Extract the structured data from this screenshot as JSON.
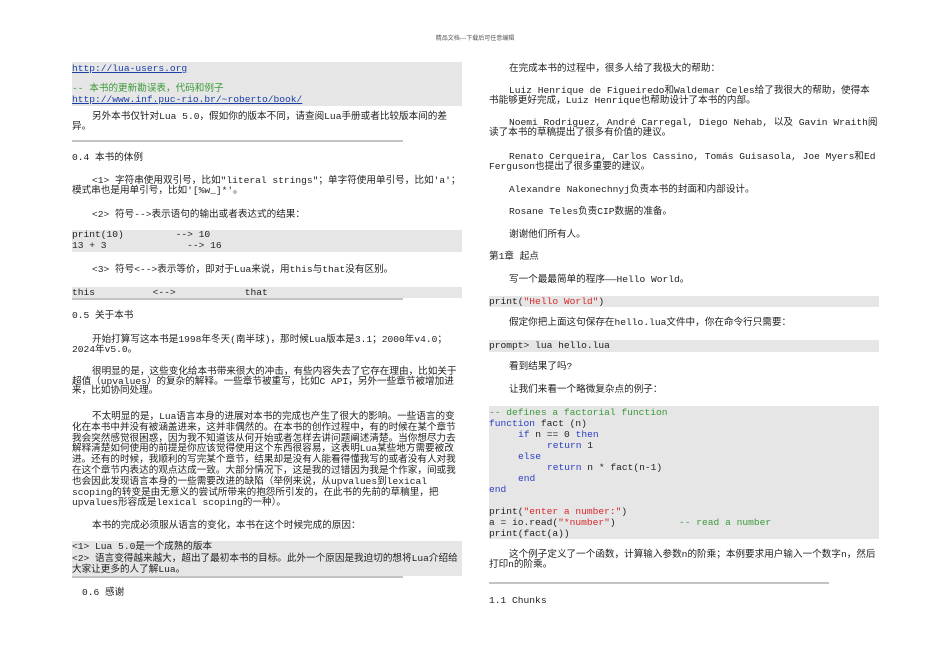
{
  "header": "精品文档---下载后可任意编辑",
  "left": {
    "box1": {
      "url1": "http://lua-users.org",
      "comment": "-- 本书的更新勘误表，代码和例子",
      "url2": "http://www.inf.puc-rio.br/~roberto/book/"
    },
    "p_version": "另外本书仅针对Lua 5.0，假如你的版本不同，请查阅Lua手册或者比较版本间的差异。",
    "h_04": "0.4 本书的体例",
    "p_rule1": "<1> 字符串使用双引号，比如\"literal strings\"；单字符使用单引号，比如'a'；模式串也是用单引号，比如'[%w_]*'。",
    "p_rule2": "<2> 符号-->表示语句的输出或者表达式的结果：",
    "code_rule2": [
      "print(10)         --> 10",
      "13 + 3              --> 16"
    ],
    "p_rule3": "<3> 符号<-->表示等价，即对于Lua来说，用this与that没有区别。",
    "code_rule3": "this          <-->            that",
    "h_05": "0.5 关于本书",
    "p_history": "开始打算写这本书是1998年冬天(南半球)，那时候Lua版本是3.1；2000年v4.0；2024年v5.0。",
    "p_impact": "很明显的是，这些变化给本书带来很大的冲击，有些内容失去了它存在理由，比如关于超值（upvalues）的复杂的解释。一些章节被重写，比如C API，另外一些章节被增加进来，比如协同处理。",
    "p_language": "不太明显的是，Lua语言本身的进展对本书的完成也产生了很大的影响。一些语言的变化在本书中并没有被涵盖进来，这并非偶然的。在本书的创作过程中，有的时候在某个章节我会突然感觉很困惑，因为我不知道该从何开始或者怎样去讲问题阐述清楚。当你想尽力去解释清楚如何使用的前提是你应该觉得使用这个东西很容易，这表明Lua某些地方需要被改进。还有的时候，我顺利的写完某个章节，结果却是没有人能看得懂我写的或者没有人对我在这个章节内表达的观点达成一致。大部分情况下，这是我的过错因为我是个作家，间或我也会因此发现语言本身的一些需要改进的缺陷（举例来说，从upvalues到lexical scoping的转变是由无意义的尝试所带来的抱怨所引发的，在此书的先前的草稿里，把upvalues形容成是lexical scoping的一种）。",
    "p_reasons": "本书的完成必须服从语言的变化，本书在这个时候完成的原因：",
    "box_reasons": [
      "<1> Lua 5.0是一个成熟的版本",
      "<2> 语言变得越来越大，超出了最初本书的目标。此外一个原因是我迫切的想将Lua介绍给大家让更多的人了解Lua。"
    ],
    "h_06": "0.6 感谢"
  },
  "right": {
    "p_help": "在完成本书的过程中，很多人给了我极大的帮助：",
    "p_luiz": "Luiz Henrique de Figueiredo和Waldemar Celes给了我很大的帮助，使得本书能够更好完成，Luiz Henrique也帮助设计了本书的内部。",
    "p_noemi": "Noemi Rodriguez, André Carregal, Diego Nehab, 以及 Gavin Wraith阅读了本书的草稿提出了很多有价值的建议。",
    "p_renato": "Renato Cerqueira, Carlos Cassino, Tomás Guisasola, Joe Myers和Ed Ferguson也提出了很多重要的建议。",
    "p_alex": "Alexandre Nakonechnyj负责本书的封面和内部设计。",
    "p_rosane": "Rosane Teles负责CIP数据的准备。",
    "p_thanks": "谢谢他们所有人。",
    "h_ch1": "第1章 起点",
    "p_hello": "写一个最最简单的程序——Hello World。",
    "code_hello": {
      "fn": "print(",
      "str": "\"Hello World\"",
      "close": ")"
    },
    "p_save": "假定你把上面这句保存在hello.lua文件中，你在命令行只需要：",
    "code_prompt": "prompt> lua hello.lua",
    "p_result": "看到结果了吗?",
    "p_example": "让我们来看一个略微复杂点的例子：",
    "code_fact": {
      "l1": "-- defines a factorial function",
      "l2_kw": "function",
      "l2_rest": " fact (n)",
      "l3_kw1": "if",
      "l3_mid": " n == 0 ",
      "l3_kw2": "then",
      "l4_kw": "return",
      "l4_rest": " 1",
      "l5_kw": "else",
      "l6_kw": "return",
      "l6_rest": " n * fact(n-1)",
      "l7_kw": "end",
      "l8_kw": "end",
      "l9_fn": "print(",
      "l9_str": "\"enter a number:\"",
      "l9_close": ")",
      "l10_a": "a = io.read(",
      "l10_str": "\"*number\"",
      "l10_b": ")           ",
      "l10_cm": "-- read a number",
      "l11": "print(fact(a))"
    },
    "p_explain": "这个例子定义了一个函数，计算输入参数n的阶乘；本例要求用户输入一个数字n，然后打印n的阶乘。",
    "h_chunks": "1.1 Chunks"
  }
}
